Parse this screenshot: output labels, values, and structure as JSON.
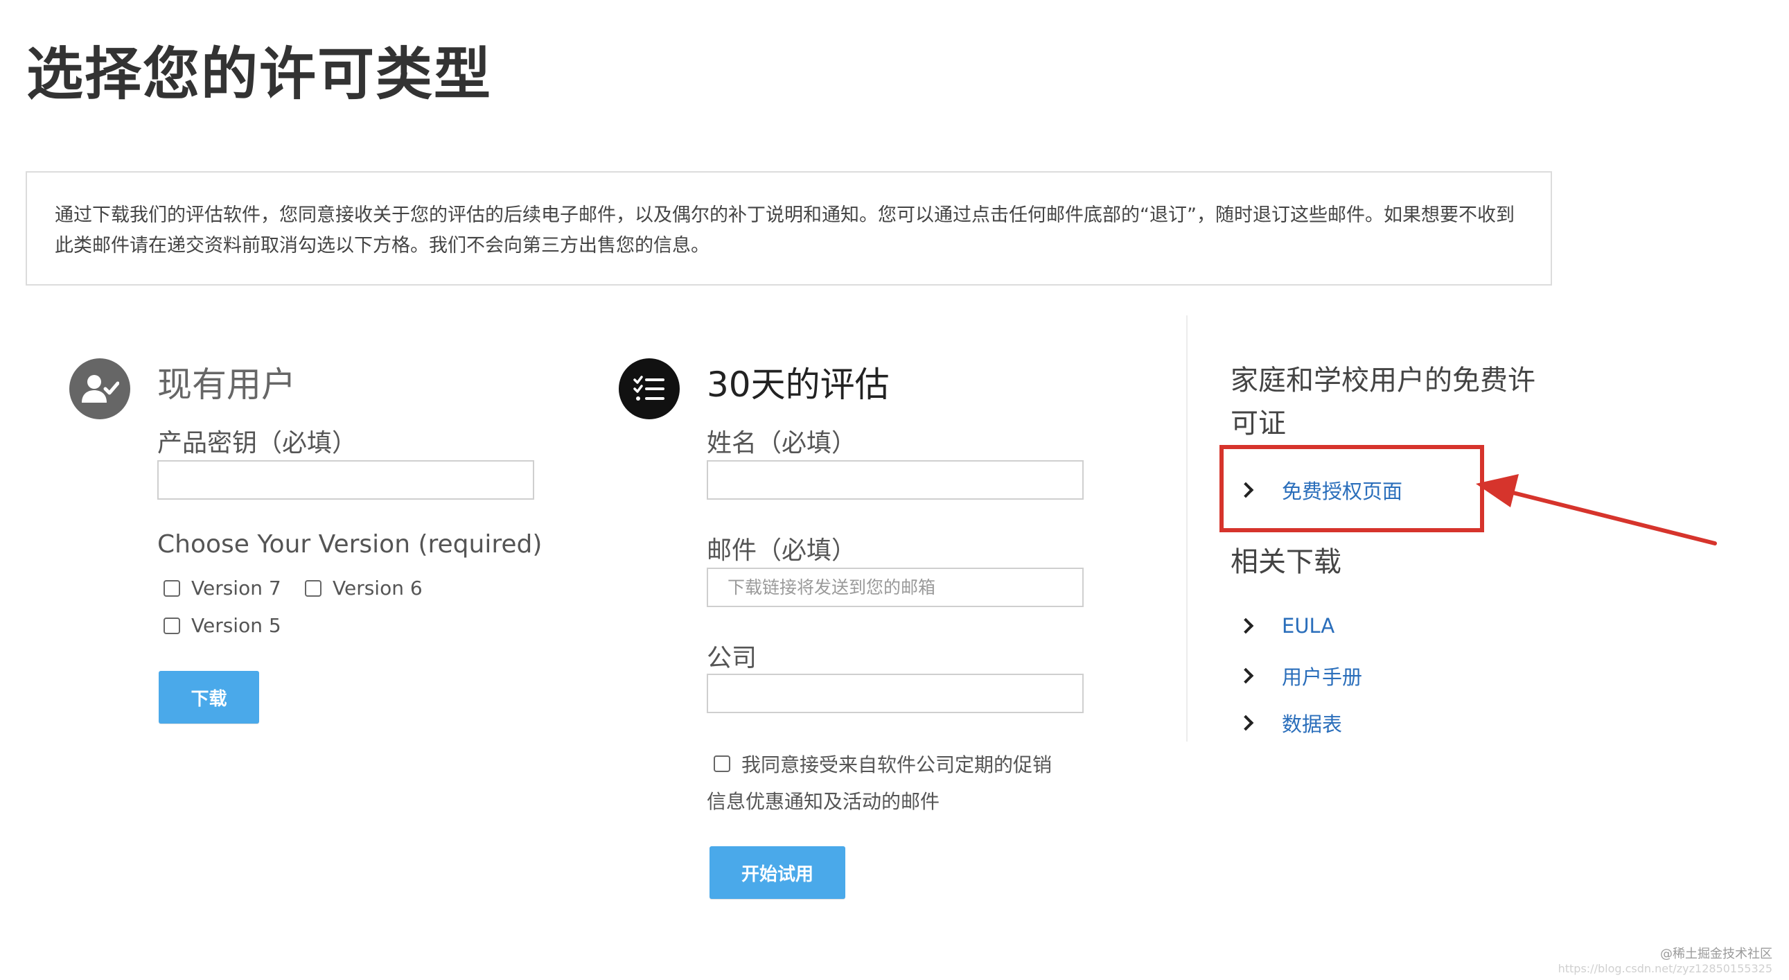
{
  "page": {
    "title": "选择您的许可类型"
  },
  "notice": {
    "text": "通过下载我们的评估软件，您同意接收关于您的评估的后续电子邮件，以及偶尔的补丁说明和通知。您可以通过点击任何邮件底部的“退订”，随时退订这些邮件。如果想要不收到此类邮件请在递交资料前取消勾选以下方格。我们不会向第三方出售您的信息。"
  },
  "existing_user": {
    "title": "现有用户",
    "product_key_label": "产品密钥（必填）",
    "product_key_value": "",
    "version_label": "Choose Your Version (required)",
    "versions": [
      {
        "label": "Version 7",
        "checked": false
      },
      {
        "label": "Version 6",
        "checked": false
      },
      {
        "label": "Version 5",
        "checked": false
      }
    ],
    "download_button": "下载"
  },
  "trial": {
    "title": "30天的评估",
    "name_label": "姓名（必填）",
    "name_value": "",
    "email_label": "邮件（必填）",
    "email_placeholder": "下载链接将发送到您的邮箱",
    "company_label": "公司",
    "company_value": "",
    "consent_line1": "我同意接受来自软件公司定期的促销",
    "consent_line2": "信息优惠通知及活动的邮件",
    "consent_checked": false,
    "start_button": "开始试用"
  },
  "sidebar": {
    "free_title_line1": "家庭和学校用户的免费许",
    "free_title_line2": "可证",
    "free_links": [
      {
        "label": "免费授权页面"
      }
    ],
    "downloads_title": "相关下载",
    "download_links": [
      {
        "label": "EULA"
      },
      {
        "label": "用户手册"
      },
      {
        "label": "数据表"
      }
    ]
  },
  "annotation": {
    "highlight_color": "#d6342c"
  },
  "watermark": {
    "main": "@稀土掘金技术社区",
    "sub": "https://blog.csdn.net/zyz12850155325"
  },
  "colors": {
    "button": "#4aa9ea",
    "link": "#2a6ebb"
  }
}
